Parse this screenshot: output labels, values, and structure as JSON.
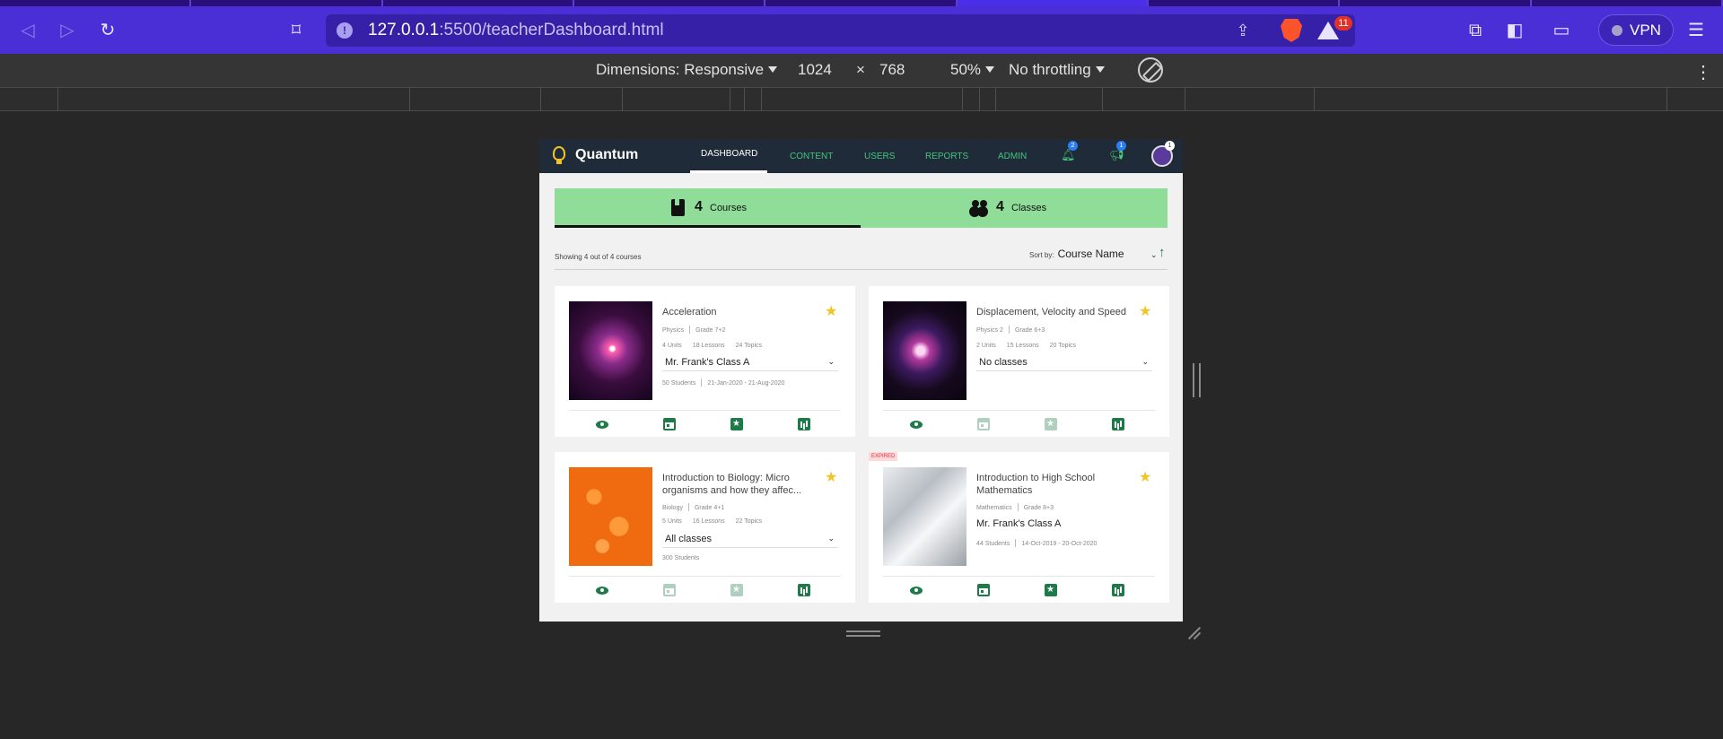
{
  "browser": {
    "url_host": "127.0.0.1",
    "url_path": ":5500/teacherDashboard.html",
    "rewards_badge": "11",
    "vpn_label": "VPN"
  },
  "devtools": {
    "dimensions_label": "Dimensions: Responsive",
    "width": "1024",
    "times": "×",
    "height": "768",
    "zoom": "50%",
    "throttling": "No throttling"
  },
  "app": {
    "logo": "Quantum",
    "nav": [
      "DASHBOARD",
      "CONTENT",
      "USERS",
      "REPORTS",
      "ADMIN"
    ],
    "notifications_badge": "2",
    "announcements_badge": "1",
    "avatar_badge": "1"
  },
  "summary": {
    "courses_count": "4",
    "courses_label": "Courses",
    "classes_count": "4",
    "classes_label": "Classes"
  },
  "listing": {
    "showing": "Showing 4 out of 4 courses",
    "sort_label": "Sort by:",
    "sort_value": "Course Name"
  },
  "courses": [
    {
      "title": "Acceleration",
      "subject": "Physics",
      "grade": "Grade 7+2",
      "units": "4 Units",
      "lessons": "18 Lessons",
      "topics": "24 Topics",
      "class": "Mr. Frank's Class A",
      "students": "50 Students",
      "dates": "21-Jan-2020 - 21-Aug-2020"
    },
    {
      "title": "Displacement, Velocity and Speed",
      "subject": "Physics 2",
      "grade": "Grade 6+3",
      "units": "2 Units",
      "lessons": "15 Lessons",
      "topics": "20 Topics",
      "class": "No classes"
    },
    {
      "title": "Introduction to Biology: Micro organisms and how they affec...",
      "subject": "Biology",
      "grade": "Grade 4+1",
      "units": "5 Units",
      "lessons": "16 Lessons",
      "topics": "22 Topics",
      "class": "All classes",
      "students": "300 Students"
    },
    {
      "title": "Introduction to High School Mathematics",
      "subject": "Mathematics",
      "grade": "Grade 8+3",
      "class": "Mr. Frank's Class A",
      "students": "44 Students",
      "dates": "14-Oct-2019 - 20-Oct-2020",
      "badge": "EXPIRED"
    }
  ],
  "colors": {
    "accent_green": "#1f7a4a",
    "summary_bg": "#8fdd99",
    "nav_bg": "#1f2b38",
    "star": "#f2c524",
    "browser_toolbar": "#4a2fd6"
  }
}
